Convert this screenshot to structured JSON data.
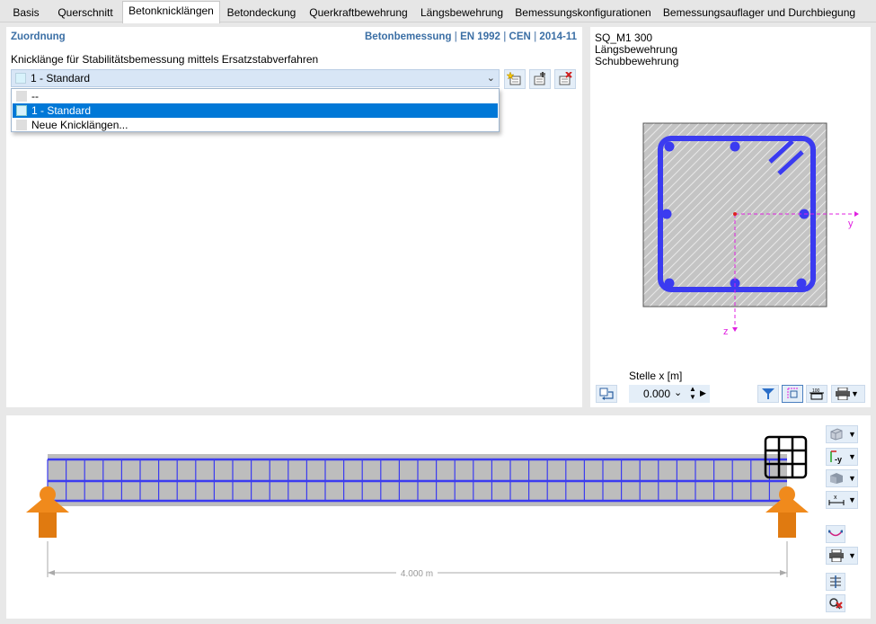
{
  "tabs": [
    {
      "label": "Basis"
    },
    {
      "label": "Querschnitt"
    },
    {
      "label": "Betonknicklängen"
    },
    {
      "label": "Betondeckung"
    },
    {
      "label": "Querkraftbewehrung"
    },
    {
      "label": "Längsbewehrung"
    },
    {
      "label": "Bemessungskonfigurationen"
    },
    {
      "label": "Bemessungsauflager und Durchbiegung"
    }
  ],
  "active_tab": "Betonknicklängen",
  "left_panel": {
    "title": "Zuordnung",
    "standard": {
      "part1": "Betonbemessung",
      "part2": "EN 1992",
      "part3": "CEN",
      "part4": "2014-11",
      "separator": "|"
    },
    "field_label": "Knicklänge für Stabilitätsbemessung mittels Ersatzstabverfahren",
    "combo_value": "1 - Standard",
    "dropdown_options": [
      "--",
      "1 - Standard",
      "Neue Knicklängen..."
    ],
    "selected_option": "1 - Standard"
  },
  "right_panel": {
    "section_name": "SQ_M1 300",
    "line2": "Längsbewehrung",
    "line3": "Schubbewehrung",
    "axis_y": "y",
    "axis_z": "z",
    "stelle_label": "Stelle x [m]",
    "stelle_value": "0.000"
  },
  "bottom_panel": {
    "dimension_label": "4.000 m"
  },
  "colors": {
    "accent": "#3b6fa5",
    "selection": "#0078d7",
    "rebar": "#3b3bf0",
    "axis": "#e020e0",
    "support": "#f08a1c"
  },
  "icons": {
    "tb1": "new-icon",
    "tb2": "edit-icon",
    "tb3": "delete-icon",
    "section_tools": "section-switch-icon",
    "filter": "filter-icon",
    "dim": "dimension-icon",
    "print": "print-icon"
  }
}
